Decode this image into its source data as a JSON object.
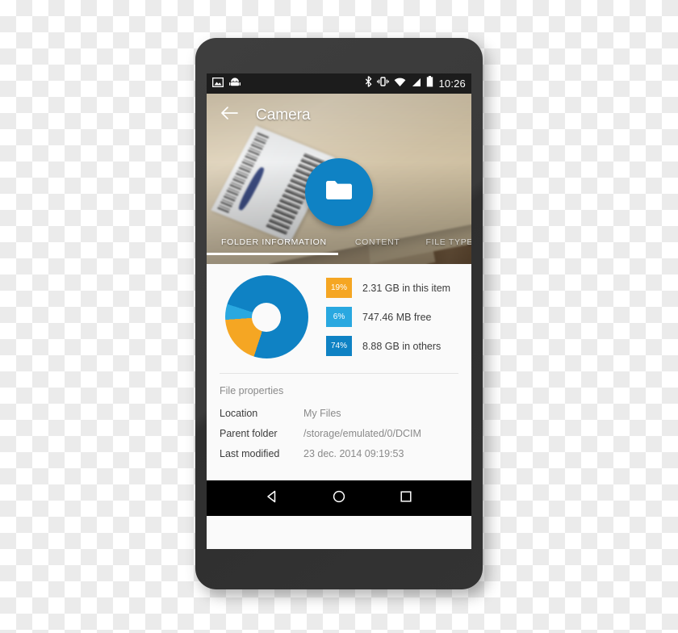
{
  "device": {
    "name": "android-phone"
  },
  "statusbar": {
    "left_icons": [
      "image-icon",
      "android-robot-icon"
    ],
    "right_icons": [
      "bluetooth-icon",
      "vibrate-icon",
      "wifi-icon",
      "signal-icon",
      "battery-icon"
    ],
    "clock": "10:26"
  },
  "toolbar": {
    "back_label": "back-arrow",
    "title": "Camera"
  },
  "fab": {
    "icon": "folder-icon",
    "color": "#0f82c4"
  },
  "tabs": [
    {
      "label": "FOLDER INFORMATION",
      "active": true
    },
    {
      "label": "CONTENT",
      "active": false
    },
    {
      "label": "FILE TYPES",
      "active": false
    }
  ],
  "chart_data": {
    "type": "pie",
    "title": "",
    "categories": [
      "2.31 GB in this item",
      "747.46 MB free",
      "8.88 GB in others"
    ],
    "values": [
      19,
      6,
      74
    ],
    "value_labels": [
      "19%",
      "6%",
      "74%"
    ],
    "colors": [
      "#f5a623",
      "#29a8e0",
      "#0f82c4"
    ],
    "legend_position": "right",
    "donut": true
  },
  "legend": [
    {
      "percent": "19%",
      "label": "2.31 GB in this item",
      "color": "#f5a623"
    },
    {
      "percent": "6%",
      "label": "747.46 MB free",
      "color": "#29a8e0"
    },
    {
      "percent": "74%",
      "label": "8.88 GB in others",
      "color": "#0f82c4"
    }
  ],
  "properties": {
    "title": "File properties",
    "rows": [
      {
        "key": "Location",
        "value": "My Files"
      },
      {
        "key": "Parent folder",
        "value": "/storage/emulated/0/DCIM"
      },
      {
        "key": "Last modified",
        "value": "23 dec. 2014 09:19:53"
      }
    ]
  },
  "navbar": {
    "buttons": [
      "back-triangle-icon",
      "home-circle-icon",
      "recents-square-icon"
    ]
  }
}
